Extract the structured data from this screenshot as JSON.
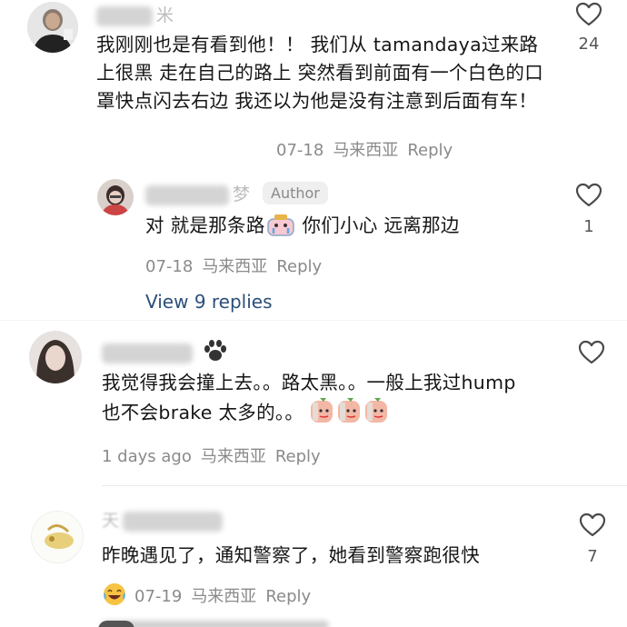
{
  "comments": [
    {
      "username": "米",
      "text": "我刚刚也是有看到他！！ 我们从 tamandaya过来路上很黑 走在自己的路上 突然看到前面有一个白色的口罩快点闪去右边 我还以为他是没有注意到后面有车！",
      "date": "07-18",
      "location": "马来西亚",
      "reply_label": "Reply",
      "likes": "24"
    },
    {
      "username": "梦",
      "badge": "Author",
      "text_before": "对 就是那条路",
      "text_after": "你们小心 远离那边",
      "date": "07-18",
      "location": "马来西亚",
      "reply_label": "Reply",
      "likes": "1"
    },
    {
      "text": "我觉得我会撞上去。。路太黑。。一般上我过hump也不会brake 太多的。。",
      "date": "1 days ago",
      "location": "马来西亚",
      "reply_label": "Reply"
    },
    {
      "username": "天",
      "text": "昨晚遇见了，通知警察了，她看到警察跑很快",
      "date": "07-19",
      "location": "马来西亚",
      "reply_label": "Reply",
      "likes": "7"
    }
  ],
  "view_replies_label": "View 9 replies",
  "icons": {
    "like": "heart-outline-icon",
    "paw": "paw-emoji-icon",
    "tears": "tears-of-joy-emoji-icon",
    "peach": "peach-sticker-icon"
  }
}
